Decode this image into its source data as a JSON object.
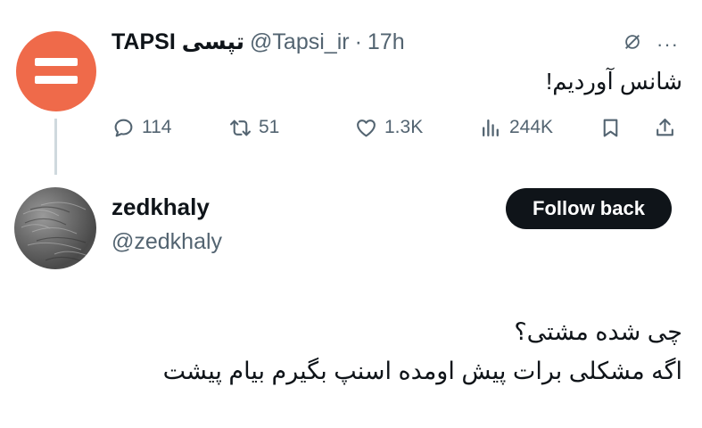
{
  "tweet": {
    "author_name": "TAPSI تپسی",
    "handle": "@Tapsi_ir",
    "separator": "·",
    "time": "17h",
    "more_label": "···",
    "text": "شانس آوردیم!",
    "avatar_color": "#ef6a4a",
    "stats": {
      "replies": "114",
      "retweets": "51",
      "likes": "1.3K",
      "views": "244K"
    }
  },
  "profile": {
    "name": "zedkhaly",
    "handle": "@zedkhaly",
    "follow_label": "Follow back",
    "bio_lines": [
      "چی شده مشتی؟",
      "اگه مشکلی برات پیش اومده اسنپ بگیرم بیام پیشت"
    ]
  },
  "colors": {
    "text": "#0f1419",
    "secondary": "#536471",
    "thread_line": "#cfd9de",
    "button_bg": "#0f1419",
    "button_text": "#ffffff"
  }
}
